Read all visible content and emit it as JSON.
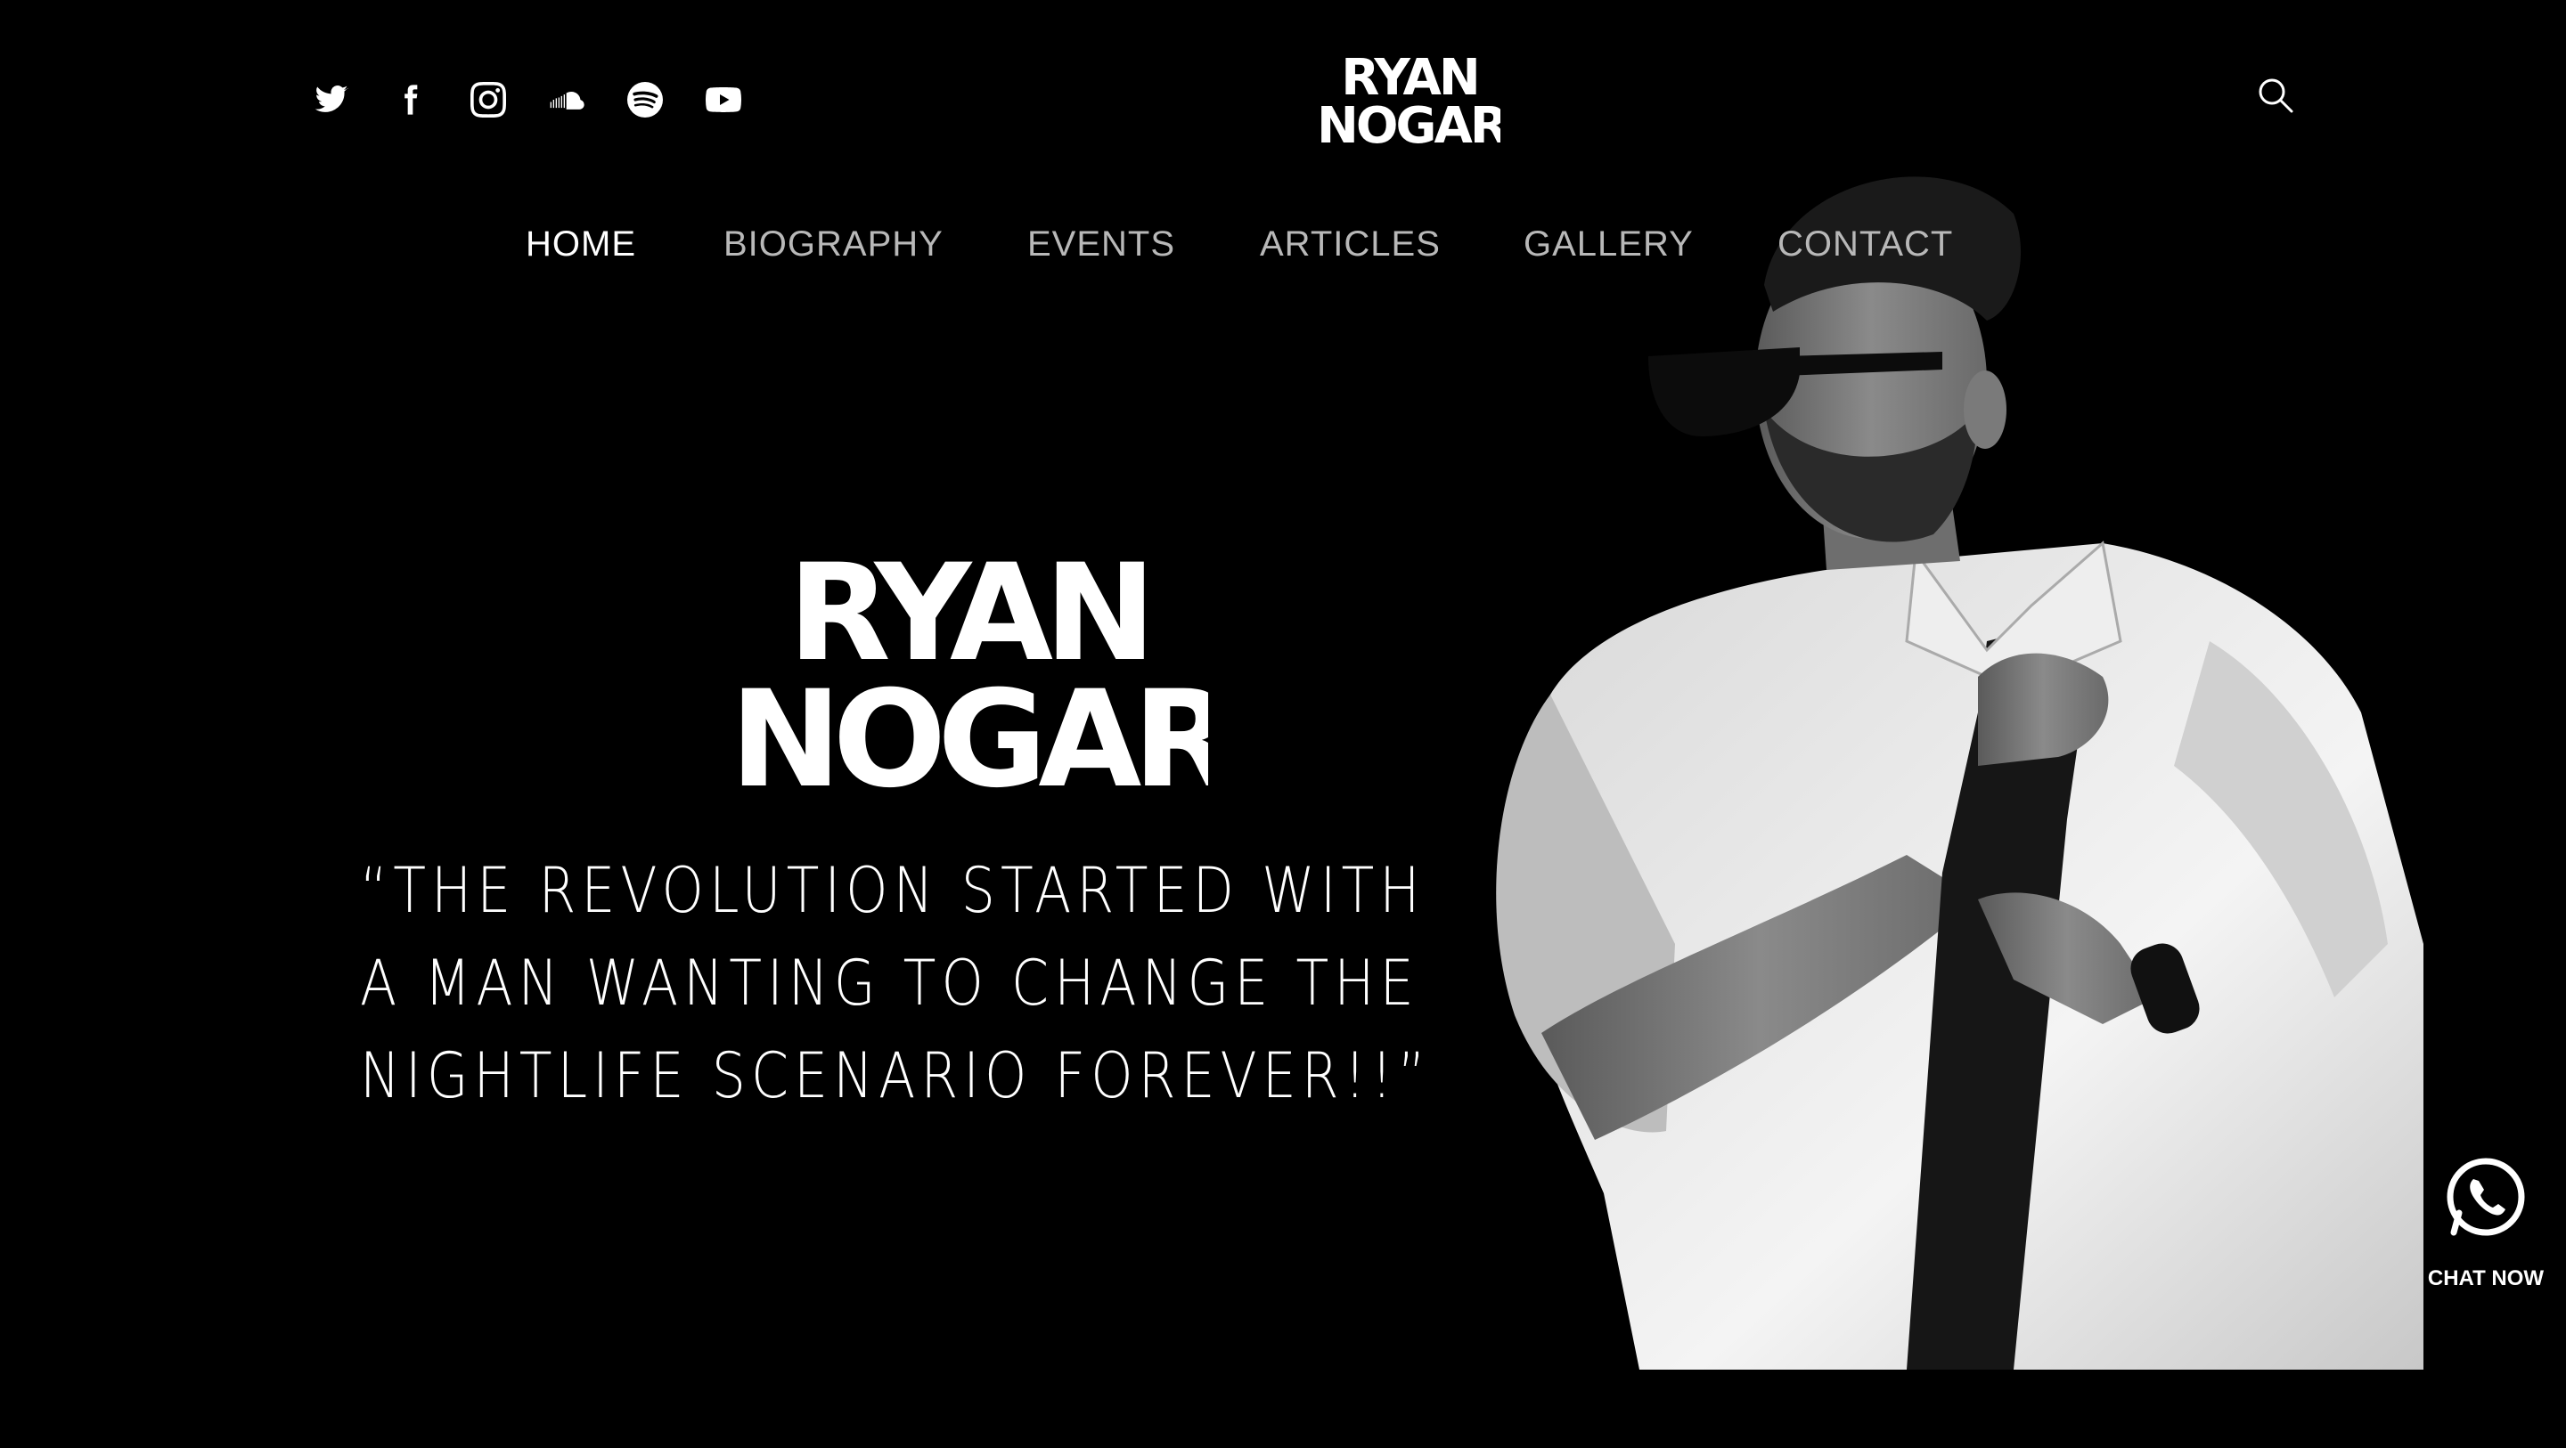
{
  "brand": {
    "name": "RYAN NOGAR",
    "logo_line1": "RYAN",
    "logo_line2": "NOGAR"
  },
  "social": [
    {
      "name": "twitter-icon"
    },
    {
      "name": "facebook-icon"
    },
    {
      "name": "instagram-icon"
    },
    {
      "name": "soundcloud-icon"
    },
    {
      "name": "spotify-icon"
    },
    {
      "name": "youtube-icon"
    }
  ],
  "search": {
    "icon": "search-icon"
  },
  "nav": {
    "items": [
      {
        "label": "HOME",
        "active": true
      },
      {
        "label": "BIOGRAPHY"
      },
      {
        "label": "EVENTS"
      },
      {
        "label": "ARTICLES"
      },
      {
        "label": "GALLERY"
      },
      {
        "label": "CONTACT"
      }
    ]
  },
  "hero": {
    "quote_lines": [
      "“THE REVOLUTION STARTED WITH",
      "A MAN WANTING TO CHANGE THE",
      "NIGHTLIFE SCENARIO FOREVER!!”"
    ]
  },
  "chat": {
    "label": "CHAT NOW",
    "icon": "whatsapp-icon"
  },
  "colors": {
    "background": "#000000",
    "text": "#ffffff",
    "nav_inactive": "#b8b8b8"
  }
}
